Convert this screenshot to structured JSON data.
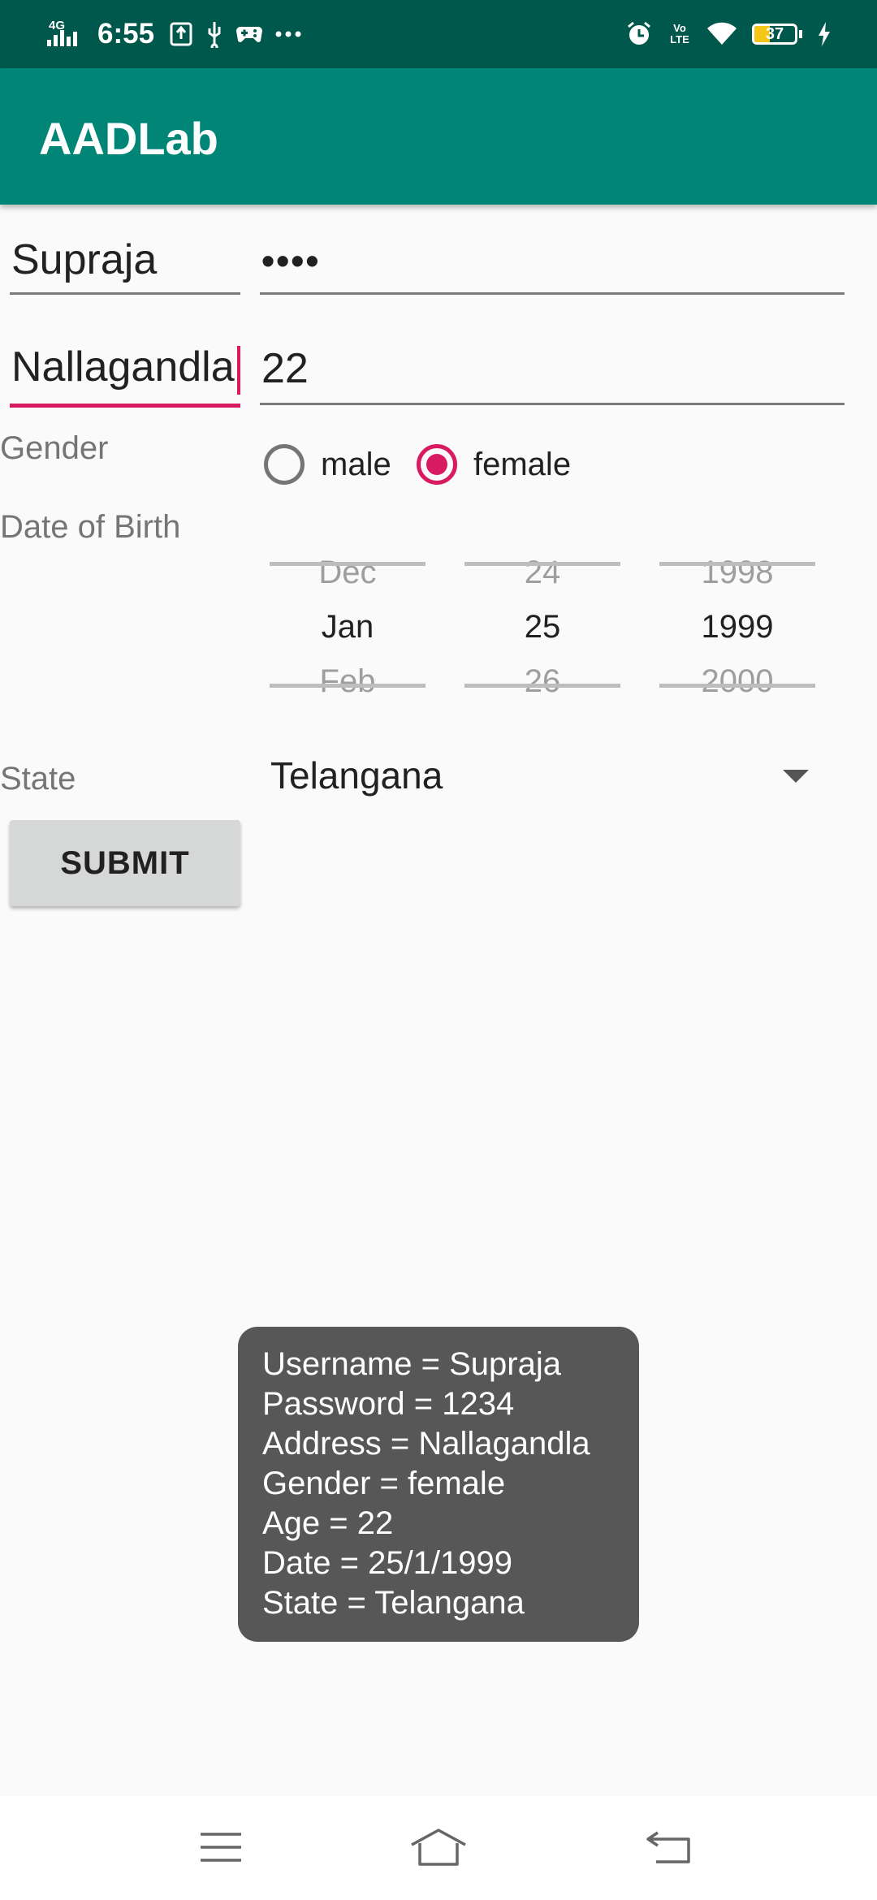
{
  "status_bar": {
    "time": "6:55",
    "network": "4G",
    "volte": "Vo LTE",
    "battery": "37",
    "battery_level_percent": 37,
    "icons": [
      "signal-icon",
      "usb-debug-icon",
      "usb-icon",
      "gamepad-icon",
      "more-icon",
      "alarm-icon",
      "volte-icon",
      "wifi-icon",
      "battery-icon",
      "charging-icon"
    ]
  },
  "app_bar": {
    "title": "AADLab"
  },
  "form": {
    "username": "Supraja",
    "password_masked": "••••",
    "address": "Nallagandla",
    "age": "22",
    "gender_label": "Gender",
    "gender_options": [
      {
        "label": "male",
        "checked": false
      },
      {
        "label": "female",
        "checked": true
      }
    ],
    "dob_label": "Date of Birth",
    "date_picker": {
      "month": {
        "prev": "Dec",
        "selected": "Jan",
        "next": "Feb"
      },
      "day": {
        "prev": "24",
        "selected": "25",
        "next": "26"
      },
      "year": {
        "prev": "1998",
        "selected": "1999",
        "next": "2000"
      }
    },
    "state_label": "State",
    "state_value": "Telangana",
    "submit_label": "SUBMIT"
  },
  "toast": {
    "lines": [
      "Username = Supraja",
      "Password = 1234",
      "Address = Nallagandla",
      "Gender = female",
      "Age = 22",
      "Date = 25/1/1999",
      "State = Telangana"
    ]
  },
  "colors": {
    "status_bar": "#00574b",
    "app_bar": "#008577",
    "accent": "#d81b60",
    "toast_bg": "#575757",
    "battery_fill": "#f5c518"
  }
}
